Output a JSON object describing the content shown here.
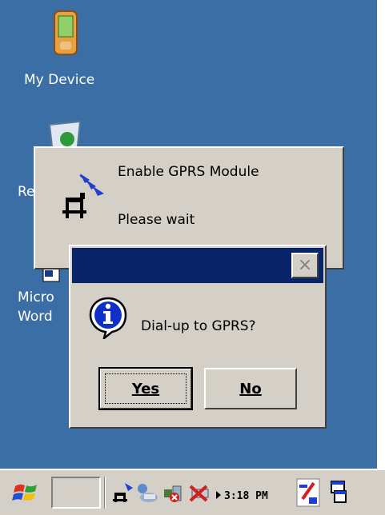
{
  "desktop": {
    "icons": [
      {
        "label": "My Device",
        "icon": "pda-device-icon"
      },
      {
        "label": "Re",
        "icon": "recycle-bin-icon"
      },
      {
        "label": "Micro\nWord",
        "icon": "word-document-icon"
      }
    ],
    "background_color": "#3a6ea5"
  },
  "progress_window": {
    "title_line": "Enable GPRS Module",
    "status_line": "Please wait",
    "icon": "gprs-antenna-icon"
  },
  "dialog": {
    "message": "Dial-up to GPRS?",
    "close_glyph": "×",
    "icon": "info-icon",
    "yes_label": "Yes",
    "no_label": "No",
    "titlebar_color": "#0a246a"
  },
  "taskbar": {
    "start_icon": "windows-flag-icon",
    "clock": "3:18 PM",
    "tray_icons": [
      "network-connection-icon",
      "user-connection-icon",
      "audio-icon",
      "battery-alert-icon",
      "tray-arrow-icon",
      "input-panel-icon",
      "desktop-switch-icon"
    ]
  }
}
